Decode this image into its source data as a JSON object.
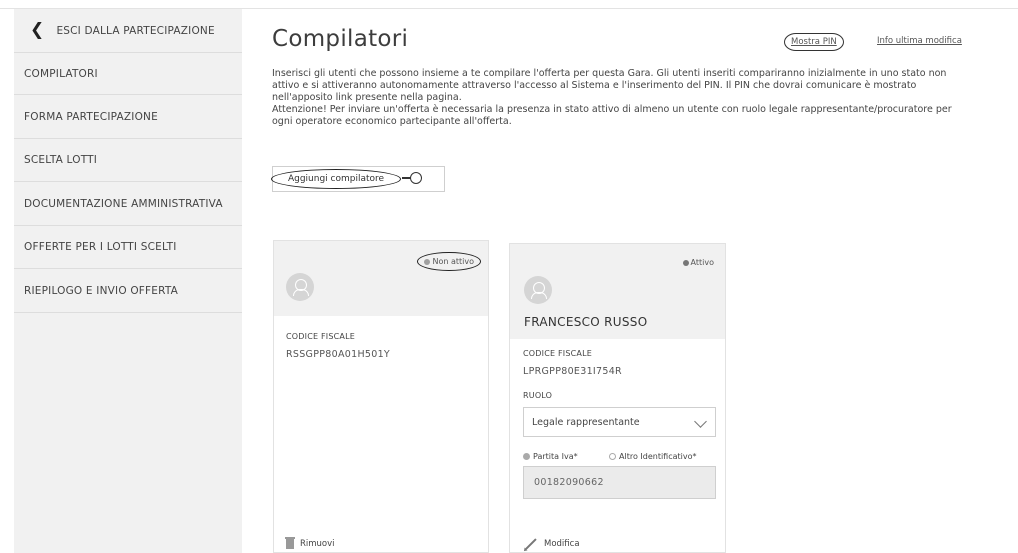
{
  "sidebar": {
    "back_label": "ESCI DALLA PARTECIPAZIONE",
    "items": [
      {
        "label": "COMPILATORI"
      },
      {
        "label": "FORMA PARTECIPAZIONE"
      },
      {
        "label": "SCELTA LOTTI"
      },
      {
        "label": "DOCUMENTAZIONE AMMINISTRATIVA"
      },
      {
        "label": "OFFERTE PER I LOTTI SCELTI"
      },
      {
        "label": "RIEPILOGO E INVIO OFFERTA"
      }
    ]
  },
  "header": {
    "title": "Compilatori",
    "show_pin_link": "Mostra PIN",
    "info_link": "Info ultima modifica"
  },
  "intro": {
    "line1": "Inserisci gli utenti che possono insieme a te compilare l'offerta per questa Gara. Gli utenti inseriti compariranno inizialmente in uno stato non attivo e si attiveranno autonomamente attraverso l'accesso al Sistema e l'inserimento del PIN. Il PIN che dovrai comunicare è mostrato nell'apposito link presente nella pagina.",
    "line2": "Attenzione! Per inviare un'offerta è necessaria la presenza in stato attivo di almeno un utente con ruolo legale rappresentante/procuratore per ogni operatore economico partecipante all'offerta."
  },
  "add_button": {
    "label": "Aggiungi compilatore",
    "icon": "plus-circle-icon"
  },
  "cards": [
    {
      "status": "Non attivo",
      "cf_label": "CODICE FISCALE",
      "cf_value": "RSSGPP80A01H501Y",
      "action": "Rimuovi"
    },
    {
      "status": "Attivo",
      "name": "FRANCESCO RUSSO",
      "cf_label": "CODICE FISCALE",
      "cf_value": "LPRGPP80E31I754R",
      "role_label": "RUOLO",
      "role_value": "Legale rappresentante",
      "radio1": "Partita Iva*",
      "radio2": "Altro Identificativo*",
      "piva_value": "00182090662",
      "action": "Modifica"
    }
  ]
}
